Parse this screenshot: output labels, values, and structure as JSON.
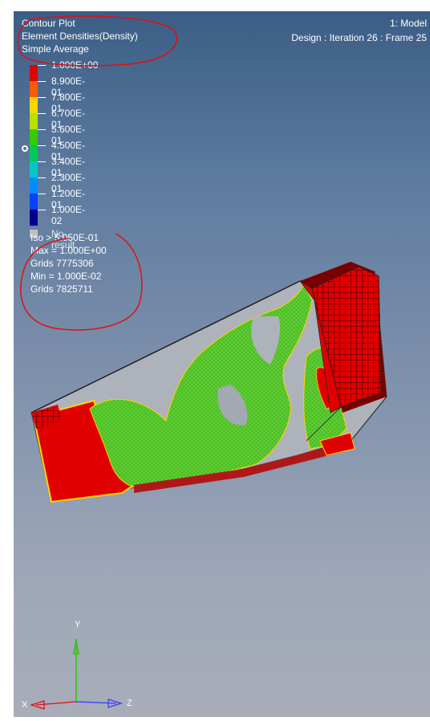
{
  "header": {
    "plot_type": "Contour Plot",
    "result_type": "Element Densities(Density)",
    "averaging": "Simple Average",
    "model": "1: Model",
    "design": "Design : Iteration 26 : Frame 25"
  },
  "legend": {
    "levels": [
      "1.000E+00",
      "8.900E-01",
      "7.800E-01",
      "6.700E-01",
      "5.600E-01",
      "4.500E-01",
      "3.400E-01",
      "2.300E-01",
      "1.200E-01",
      "1.000E-02"
    ],
    "colors": [
      "#e00000",
      "#ff5a00",
      "#ffd400",
      "#b7e000",
      "#33cc00",
      "#00c85a",
      "#00c8c8",
      "#008cff",
      "#0044ff",
      "#00008c"
    ],
    "no_result": "No result"
  },
  "stats": {
    "iso": "Iso > 5.050E-01",
    "max": "Max = 1.000E+00",
    "max_grid": "Grids 7775306",
    "min": "Min = 1.000E-02",
    "min_grid": "Grids 7825711"
  },
  "triad": {
    "y": "Y",
    "x": "X",
    "z": "Z"
  },
  "colors": {
    "annotation": "#e01010",
    "model_red": "#e00000",
    "model_green": "#5ccf30"
  }
}
